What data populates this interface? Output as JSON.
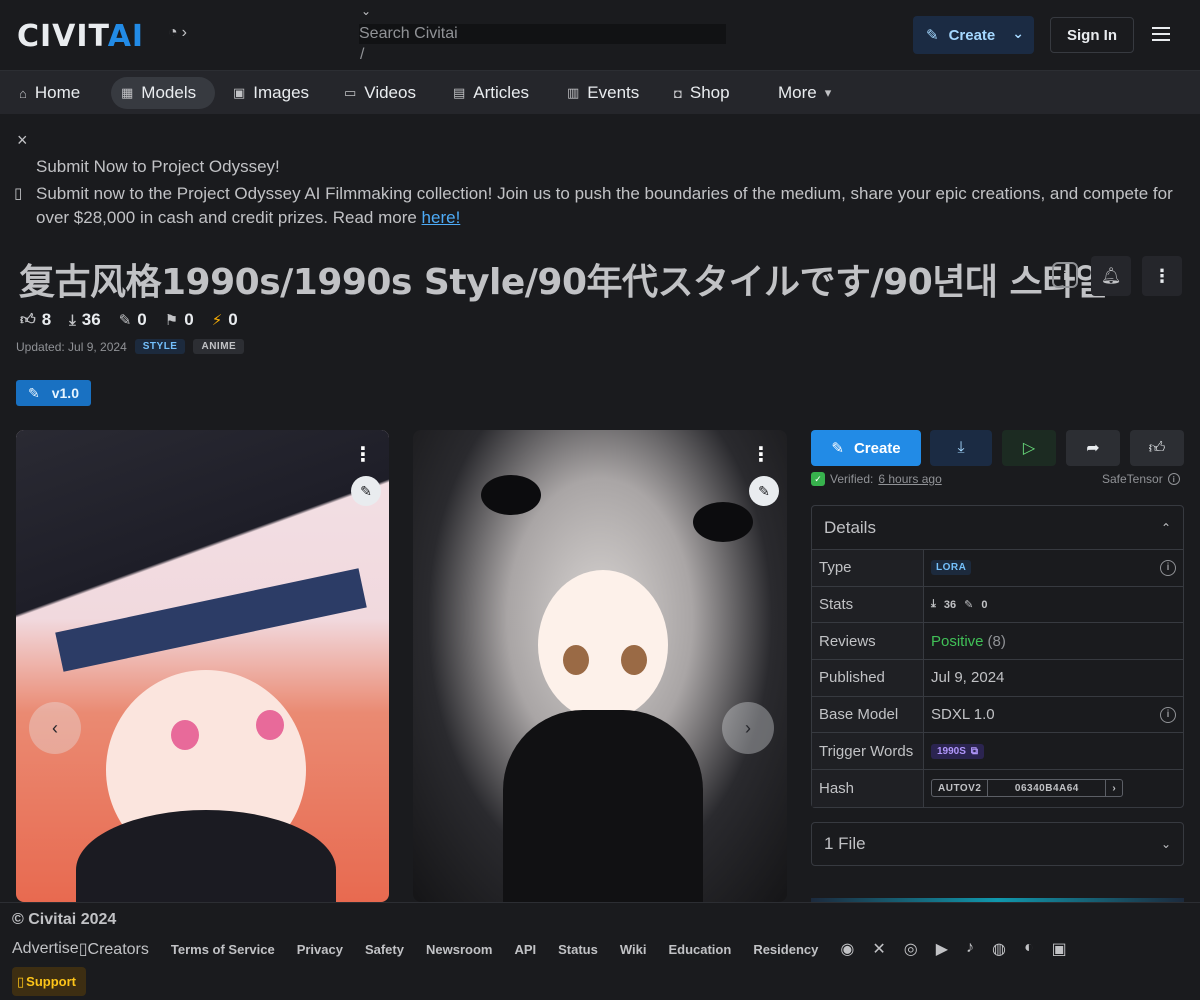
{
  "header": {
    "logo_main": "CIVIT",
    "logo_accent": "AI",
    "search": {
      "placeholder": "Search Civitai",
      "shortcut": "/"
    },
    "create_label": "Create",
    "signin_label": "Sign In"
  },
  "nav": {
    "items": [
      {
        "label": "Home",
        "icon": "home-icon"
      },
      {
        "label": "Models",
        "icon": "grid-icon",
        "active": true
      },
      {
        "label": "Images",
        "icon": "image-icon"
      },
      {
        "label": "Videos",
        "icon": "video-icon"
      },
      {
        "label": "Articles",
        "icon": "article-icon"
      },
      {
        "label": "Events",
        "icon": "calendar-icon"
      },
      {
        "label": "Shop",
        "icon": "shopping-bag-icon"
      },
      {
        "label": "More",
        "icon": "caret-down-icon"
      }
    ]
  },
  "announcement": {
    "title": "Submit Now to Project Odyssey!",
    "body": "Submit now to the Project Odyssey AI Filmmaking collection! Join us to push the boundaries of the medium, share your epic creations, and compete for over $28,000 in cash and credit prizes. Read more ",
    "link": "here!"
  },
  "model": {
    "title": "复古风格1990s/1990s Style/90年代スタイルです/90년대 스타일",
    "stats": {
      "likes": "8",
      "downloads": "36",
      "generations": "0",
      "bookmarks": "0",
      "buzz": "0"
    },
    "updated": "Updated: Jul 9, 2024",
    "tags": [
      "STYLE",
      "ANIME"
    ],
    "version": "v1.0"
  },
  "sidebar": {
    "create_label": "Create",
    "verified_label": "Verified:",
    "verified_time": "6 hours ago",
    "file_format": "SafeTensor",
    "details_title": "Details",
    "details": {
      "type_key": "Type",
      "type_val": "LORA",
      "stats_key": "Stats",
      "stats_downloads": "36",
      "stats_generations": "0",
      "reviews_key": "Reviews",
      "reviews_val": "Positive",
      "reviews_count": "(8)",
      "published_key": "Published",
      "published_val": "Jul 9, 2024",
      "base_key": "Base Model",
      "base_val": "SDXL 1.0",
      "trigger_key": "Trigger Words",
      "trigger_val": "1990S",
      "hash_key": "Hash",
      "hash_algo": "AUTOV2",
      "hash_val": "06340B4A64"
    },
    "files_label": "1 File"
  },
  "footer": {
    "copyright": "© Civitai 2024",
    "advertise": "Advertise",
    "creators": "Creators",
    "links": [
      "Terms of Service",
      "Privacy",
      "Safety",
      "Newsroom",
      "API",
      "Status",
      "Wiki",
      "Education",
      "Residency"
    ],
    "support": "Support"
  },
  "colors": {
    "accent": "#228be6",
    "positive": "#40c057",
    "buzz": "#fab005"
  }
}
